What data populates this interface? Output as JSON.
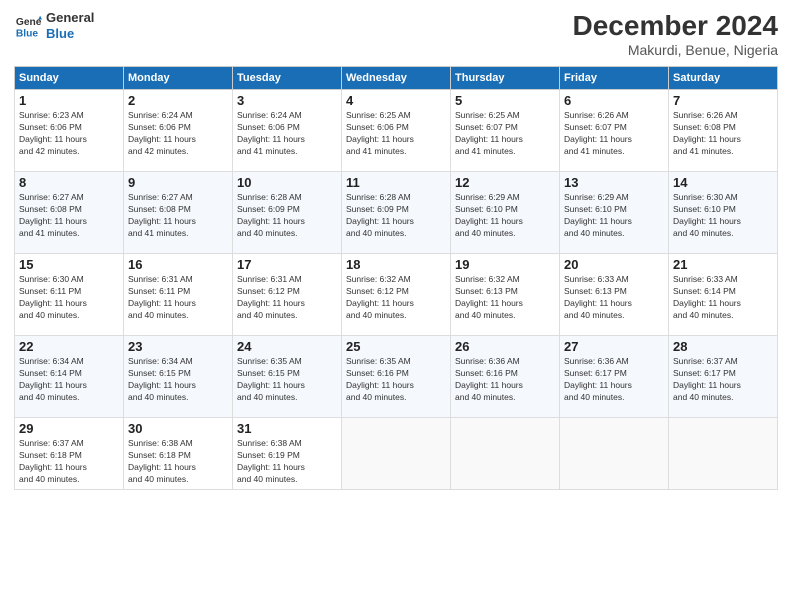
{
  "header": {
    "logo_line1": "General",
    "logo_line2": "Blue",
    "month": "December 2024",
    "location": "Makurdi, Benue, Nigeria"
  },
  "days_of_week": [
    "Sunday",
    "Monday",
    "Tuesday",
    "Wednesday",
    "Thursday",
    "Friday",
    "Saturday"
  ],
  "weeks": [
    [
      {
        "day": "1",
        "info": "Sunrise: 6:23 AM\nSunset: 6:06 PM\nDaylight: 11 hours\nand 42 minutes."
      },
      {
        "day": "2",
        "info": "Sunrise: 6:24 AM\nSunset: 6:06 PM\nDaylight: 11 hours\nand 42 minutes."
      },
      {
        "day": "3",
        "info": "Sunrise: 6:24 AM\nSunset: 6:06 PM\nDaylight: 11 hours\nand 41 minutes."
      },
      {
        "day": "4",
        "info": "Sunrise: 6:25 AM\nSunset: 6:06 PM\nDaylight: 11 hours\nand 41 minutes."
      },
      {
        "day": "5",
        "info": "Sunrise: 6:25 AM\nSunset: 6:07 PM\nDaylight: 11 hours\nand 41 minutes."
      },
      {
        "day": "6",
        "info": "Sunrise: 6:26 AM\nSunset: 6:07 PM\nDaylight: 11 hours\nand 41 minutes."
      },
      {
        "day": "7",
        "info": "Sunrise: 6:26 AM\nSunset: 6:08 PM\nDaylight: 11 hours\nand 41 minutes."
      }
    ],
    [
      {
        "day": "8",
        "info": "Sunrise: 6:27 AM\nSunset: 6:08 PM\nDaylight: 11 hours\nand 41 minutes."
      },
      {
        "day": "9",
        "info": "Sunrise: 6:27 AM\nSunset: 6:08 PM\nDaylight: 11 hours\nand 41 minutes."
      },
      {
        "day": "10",
        "info": "Sunrise: 6:28 AM\nSunset: 6:09 PM\nDaylight: 11 hours\nand 40 minutes."
      },
      {
        "day": "11",
        "info": "Sunrise: 6:28 AM\nSunset: 6:09 PM\nDaylight: 11 hours\nand 40 minutes."
      },
      {
        "day": "12",
        "info": "Sunrise: 6:29 AM\nSunset: 6:10 PM\nDaylight: 11 hours\nand 40 minutes."
      },
      {
        "day": "13",
        "info": "Sunrise: 6:29 AM\nSunset: 6:10 PM\nDaylight: 11 hours\nand 40 minutes."
      },
      {
        "day": "14",
        "info": "Sunrise: 6:30 AM\nSunset: 6:10 PM\nDaylight: 11 hours\nand 40 minutes."
      }
    ],
    [
      {
        "day": "15",
        "info": "Sunrise: 6:30 AM\nSunset: 6:11 PM\nDaylight: 11 hours\nand 40 minutes."
      },
      {
        "day": "16",
        "info": "Sunrise: 6:31 AM\nSunset: 6:11 PM\nDaylight: 11 hours\nand 40 minutes."
      },
      {
        "day": "17",
        "info": "Sunrise: 6:31 AM\nSunset: 6:12 PM\nDaylight: 11 hours\nand 40 minutes."
      },
      {
        "day": "18",
        "info": "Sunrise: 6:32 AM\nSunset: 6:12 PM\nDaylight: 11 hours\nand 40 minutes."
      },
      {
        "day": "19",
        "info": "Sunrise: 6:32 AM\nSunset: 6:13 PM\nDaylight: 11 hours\nand 40 minutes."
      },
      {
        "day": "20",
        "info": "Sunrise: 6:33 AM\nSunset: 6:13 PM\nDaylight: 11 hours\nand 40 minutes."
      },
      {
        "day": "21",
        "info": "Sunrise: 6:33 AM\nSunset: 6:14 PM\nDaylight: 11 hours\nand 40 minutes."
      }
    ],
    [
      {
        "day": "22",
        "info": "Sunrise: 6:34 AM\nSunset: 6:14 PM\nDaylight: 11 hours\nand 40 minutes."
      },
      {
        "day": "23",
        "info": "Sunrise: 6:34 AM\nSunset: 6:15 PM\nDaylight: 11 hours\nand 40 minutes."
      },
      {
        "day": "24",
        "info": "Sunrise: 6:35 AM\nSunset: 6:15 PM\nDaylight: 11 hours\nand 40 minutes."
      },
      {
        "day": "25",
        "info": "Sunrise: 6:35 AM\nSunset: 6:16 PM\nDaylight: 11 hours\nand 40 minutes."
      },
      {
        "day": "26",
        "info": "Sunrise: 6:36 AM\nSunset: 6:16 PM\nDaylight: 11 hours\nand 40 minutes."
      },
      {
        "day": "27",
        "info": "Sunrise: 6:36 AM\nSunset: 6:17 PM\nDaylight: 11 hours\nand 40 minutes."
      },
      {
        "day": "28",
        "info": "Sunrise: 6:37 AM\nSunset: 6:17 PM\nDaylight: 11 hours\nand 40 minutes."
      }
    ],
    [
      {
        "day": "29",
        "info": "Sunrise: 6:37 AM\nSunset: 6:18 PM\nDaylight: 11 hours\nand 40 minutes."
      },
      {
        "day": "30",
        "info": "Sunrise: 6:38 AM\nSunset: 6:18 PM\nDaylight: 11 hours\nand 40 minutes."
      },
      {
        "day": "31",
        "info": "Sunrise: 6:38 AM\nSunset: 6:19 PM\nDaylight: 11 hours\nand 40 minutes."
      },
      {
        "day": "",
        "info": ""
      },
      {
        "day": "",
        "info": ""
      },
      {
        "day": "",
        "info": ""
      },
      {
        "day": "",
        "info": ""
      }
    ]
  ]
}
